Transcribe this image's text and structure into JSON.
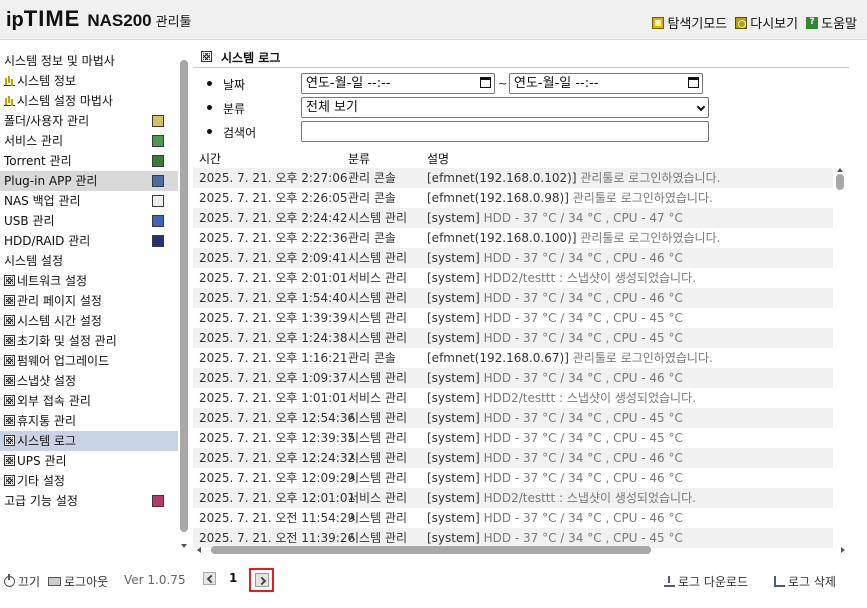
{
  "header": {
    "logo_ip": "ip",
    "logo_time": "TIME",
    "logo_model": "NAS200",
    "logo_suffix": "관리툴",
    "links": [
      {
        "label": "탐색기모드",
        "icon": "explore-icon"
      },
      {
        "label": "다시보기",
        "icon": "refresh-icon"
      },
      {
        "label": "도움말",
        "icon": "help-icon"
      }
    ]
  },
  "sidebar": {
    "items": [
      {
        "label": "시스템 정보 및 마법사",
        "lead": "",
        "right": ""
      },
      {
        "label": "시스템 정보",
        "lead": "bars",
        "right": ""
      },
      {
        "label": "시스템 설정 마법사",
        "lead": "bars",
        "right": ""
      },
      {
        "label": "폴더/사용자 관리",
        "lead": "",
        "right": "folder"
      },
      {
        "label": "서비스 관리",
        "lead": "",
        "right": "service"
      },
      {
        "label": "Torrent 관리",
        "lead": "",
        "right": "torrent"
      },
      {
        "label": "Plug-in APP 관리",
        "lead": "",
        "right": "plugin",
        "state": "active"
      },
      {
        "label": "NAS 백업 관리",
        "lead": "",
        "right": "backup"
      },
      {
        "label": "USB 관리",
        "lead": "",
        "right": "usb"
      },
      {
        "label": "HDD/RAID 관리",
        "lead": "",
        "right": "raid"
      },
      {
        "label": "시스템 설정",
        "lead": "",
        "right": ""
      },
      {
        "label": "네트워크 설정",
        "lead": "box",
        "right": ""
      },
      {
        "label": "관리 페이지 설정",
        "lead": "box",
        "right": ""
      },
      {
        "label": "시스템 시간 설정",
        "lead": "box",
        "right": ""
      },
      {
        "label": "초기화 및 설정 관리",
        "lead": "box",
        "right": ""
      },
      {
        "label": "펌웨어 업그레이드",
        "lead": "box",
        "right": ""
      },
      {
        "label": "스냅샷 설정",
        "lead": "box",
        "right": ""
      },
      {
        "label": "외부 접속 관리",
        "lead": "box",
        "right": ""
      },
      {
        "label": "휴지통 관리",
        "lead": "box",
        "right": ""
      },
      {
        "label": "시스템 로그",
        "lead": "box",
        "right": "",
        "state": "current"
      },
      {
        "label": "UPS 관리",
        "lead": "box",
        "right": ""
      },
      {
        "label": "기타 설정",
        "lead": "box",
        "right": ""
      },
      {
        "label": "고급 기능 설정",
        "lead": "",
        "right": "adv"
      }
    ]
  },
  "main": {
    "title": "시스템 로그",
    "filters": {
      "date_label": "날짜",
      "date_from": "연도-월-일  --:--",
      "date_sep": "~",
      "date_to": "연도-월-일  --:--",
      "category_label": "분류",
      "category_value": "전체 보기",
      "search_label": "검색어",
      "search_value": ""
    },
    "table": {
      "headers": [
        "시간",
        "분류",
        "설명"
      ],
      "rows": [
        {
          "time": "2025. 7. 21. 오후 2:27:06",
          "cat": "관리 콘솔",
          "tag": "[efmnet(192.168.0.102)]",
          "msg": " 관리툴로 로그인하였습니다."
        },
        {
          "time": "2025. 7. 21. 오후 2:26:05",
          "cat": "관리 콘솔",
          "tag": "[efmnet(192.168.0.98)]",
          "msg": " 관리툴로 로그인하였습니다."
        },
        {
          "time": "2025. 7. 21. 오후 2:24:42",
          "cat": "시스템 관리",
          "tag": "[system]",
          "msg": " HDD - 37 °C / 34 °C , CPU - 47 °C"
        },
        {
          "time": "2025. 7. 21. 오후 2:22:36",
          "cat": "관리 콘솔",
          "tag": "[efmnet(192.168.0.100)]",
          "msg": " 관리툴로 로그인하였습니다."
        },
        {
          "time": "2025. 7. 21. 오후 2:09:41",
          "cat": "시스템 관리",
          "tag": "[system]",
          "msg": " HDD - 37 °C / 34 °C , CPU - 46 °C"
        },
        {
          "time": "2025. 7. 21. 오후 2:01:01",
          "cat": "서비스 관리",
          "tag": "[system]",
          "msg": " HDD2/testtt : 스냅샷이 생성되었습니다."
        },
        {
          "time": "2025. 7. 21. 오후 1:54:40",
          "cat": "시스템 관리",
          "tag": "[system]",
          "msg": " HDD - 37 °C / 34 °C , CPU - 46 °C"
        },
        {
          "time": "2025. 7. 21. 오후 1:39:39",
          "cat": "시스템 관리",
          "tag": "[system]",
          "msg": " HDD - 37 °C / 34 °C , CPU - 45 °C"
        },
        {
          "time": "2025. 7. 21. 오후 1:24:38",
          "cat": "시스템 관리",
          "tag": "[system]",
          "msg": " HDD - 37 °C / 34 °C , CPU - 45 °C"
        },
        {
          "time": "2025. 7. 21. 오후 1:16:21",
          "cat": "관리 콘솔",
          "tag": "[efmnet(192.168.0.67)]",
          "msg": " 관리툴로 로그인하였습니다."
        },
        {
          "time": "2025. 7. 21. 오후 1:09:37",
          "cat": "시스템 관리",
          "tag": "[system]",
          "msg": " HDD - 37 °C / 34 °C , CPU - 46 °C"
        },
        {
          "time": "2025. 7. 21. 오후 1:01:01",
          "cat": "서비스 관리",
          "tag": "[system]",
          "msg": " HDD2/testtt : 스냅샷이 생성되었습니다."
        },
        {
          "time": "2025. 7. 21. 오후 12:54:36",
          "cat": "시스템 관리",
          "tag": "[system]",
          "msg": " HDD - 37 °C / 34 °C , CPU - 45 °C"
        },
        {
          "time": "2025. 7. 21. 오후 12:39:35",
          "cat": "시스템 관리",
          "tag": "[system]",
          "msg": " HDD - 37 °C / 34 °C , CPU - 45 °C"
        },
        {
          "time": "2025. 7. 21. 오후 12:24:32",
          "cat": "시스템 관리",
          "tag": "[system]",
          "msg": " HDD - 37 °C / 34 °C , CPU - 46 °C"
        },
        {
          "time": "2025. 7. 21. 오후 12:09:29",
          "cat": "시스템 관리",
          "tag": "[system]",
          "msg": " HDD - 37 °C / 34 °C , CPU - 46 °C"
        },
        {
          "time": "2025. 7. 21. 오후 12:01:01",
          "cat": "서비스 관리",
          "tag": "[system]",
          "msg": " HDD2/testtt : 스냅샷이 생성되었습니다."
        },
        {
          "time": "2025. 7. 21. 오전 11:54:29",
          "cat": "시스템 관리",
          "tag": "[system]",
          "msg": " HDD - 37 °C / 34 °C , CPU - 46 °C"
        },
        {
          "time": "2025. 7. 21. 오전 11:39:26",
          "cat": "시스템 관리",
          "tag": "[system]",
          "msg": " HDD - 37 °C / 34 °C , CPU - 45 °C"
        }
      ]
    }
  },
  "footer": {
    "shutdown": "끄기",
    "logout": "로그아웃",
    "version": "Ver 1.0.75",
    "page": "1",
    "download": "로그 다운로드",
    "delete": "로그 삭제"
  }
}
